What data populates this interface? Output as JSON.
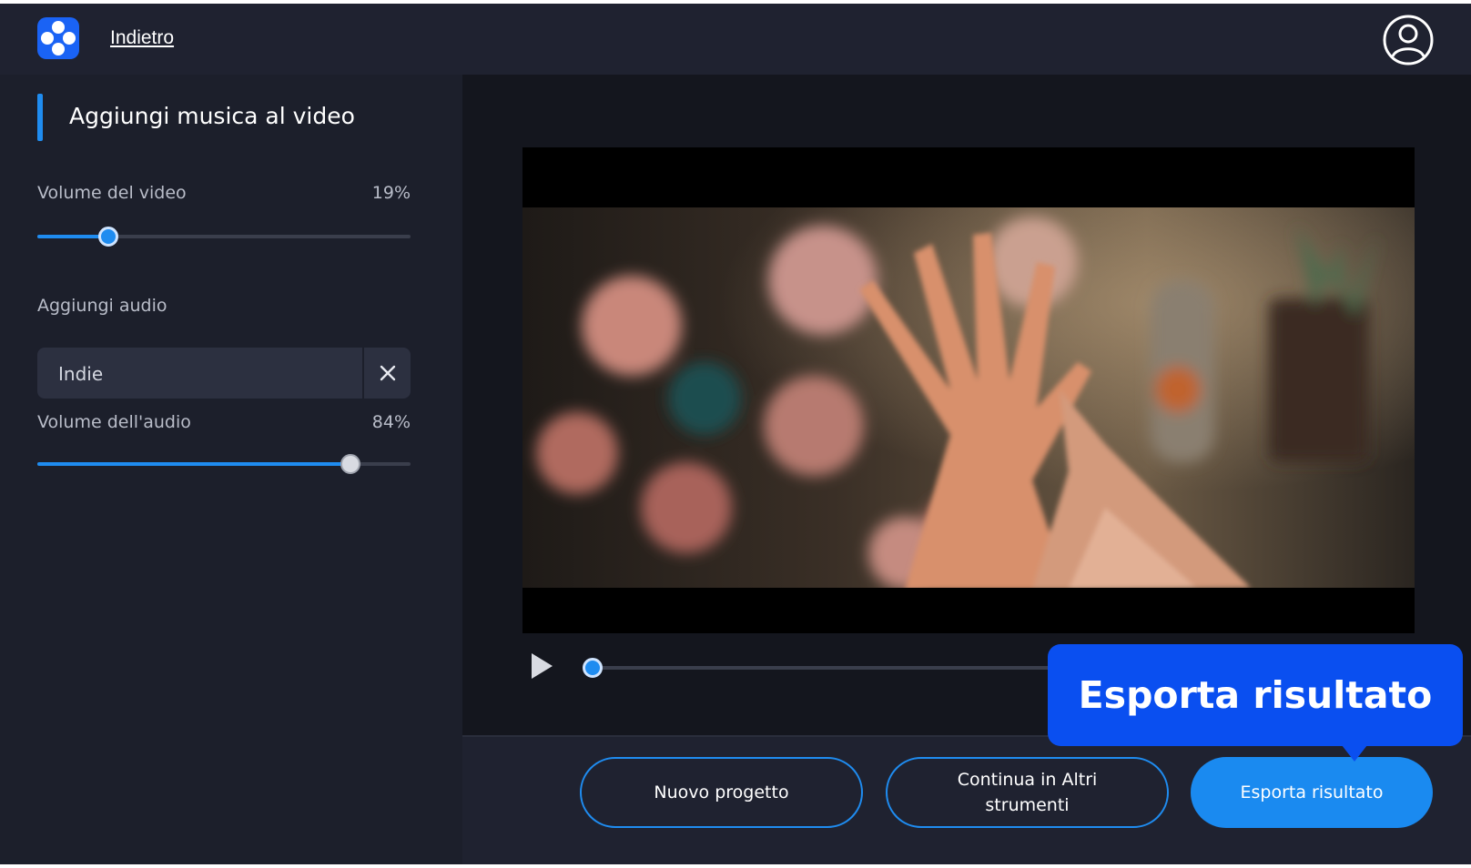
{
  "header": {
    "back_label": "Indietro",
    "logo_icon": "app-logo-icon",
    "account_icon": "user-account-icon"
  },
  "sidebar": {
    "title": "Aggiungi musica al video",
    "video_volume": {
      "label": "Volume del video",
      "value_text": "19%",
      "value": 0.19
    },
    "add_audio": {
      "label": "Aggiungi audio",
      "value": "Indie",
      "clear_icon": "close-icon"
    },
    "audio_volume": {
      "label": "Volume dell'audio",
      "value_text": "84%",
      "value": 0.84
    }
  },
  "player": {
    "play_icon": "play-icon",
    "progress": 0
  },
  "actions": {
    "new_project": "Nuovo progetto",
    "continue_tools": "Continua in Altri strumenti",
    "export": "Esporta risultato"
  },
  "tooltip": {
    "text": "Esporta risultato"
  },
  "colors": {
    "accent": "#1f8cf0",
    "tooltip": "#0a4ff0",
    "background": "#1c1f2a"
  }
}
